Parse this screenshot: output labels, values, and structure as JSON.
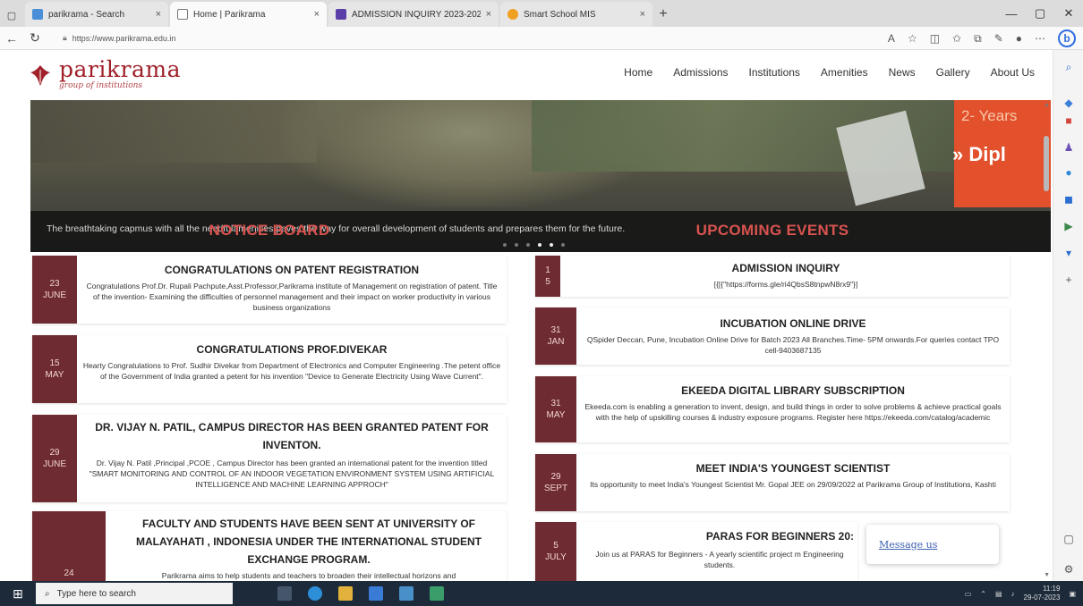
{
  "browser": {
    "tabs": [
      {
        "title": "parikrama - Search",
        "favicon": "search-favicon",
        "active": false
      },
      {
        "title": "Home | Parikrama",
        "favicon": "page-favicon",
        "active": true
      },
      {
        "title": "ADMISSION INQUIRY 2023-2024",
        "favicon": "forms-favicon",
        "active": false
      },
      {
        "title": "Smart School MIS",
        "favicon": "school-favicon",
        "active": false
      }
    ],
    "url": "https://www.parikrama.edu.in"
  },
  "site": {
    "brand": "parikrama",
    "tagline": "group of institutions",
    "nav": [
      "Home",
      "Admissions",
      "Institutions",
      "Amenities",
      "News",
      "Gallery",
      "About Us"
    ]
  },
  "hero": {
    "promo_line1": "2- Years",
    "promo_line2": "» Dipl",
    "caption": "The breathtaking capmus with all the needfulamenities paves the way for overall development of students and prepares them for the future.",
    "slide_count": 6,
    "active_slide": 4
  },
  "notice_board": {
    "title": "NOTICE BOARD",
    "items": [
      {
        "day": "23",
        "month": "JUNE",
        "title": "CONGRATULATIONS ON PATENT REGISTRATION",
        "desc": "Congratulations Prof.Dr. Rupali Pachpute,Asst.Professor,Parikrama institute of Management on registration of patent. Title of the invention- Examining the difficulties of personnel management and their impact on worker productivity in various business organizations"
      },
      {
        "day": "15",
        "month": "MAY",
        "title": "CONGRATULATIONS PROF.DIVEKAR",
        "desc": "Hearty Congratulations to Prof. Sudhir Divekar from Department of Electronics and Computer Engineering .The petent office of the Government of India granted a petent for his invention \"Device to Generate Electricity Using Wave Current\"."
      },
      {
        "day": "29",
        "month": "JUNE",
        "title": "DR. VIJAY N. PATIL, CAMPUS DIRECTOR HAS BEEN GRANTED PATENT FOR INVENTON.",
        "desc": "Dr. Vijay N. Patil ,Principal ,PCOE , Campus Director has been granted an international patent for the invention titled \"SMART MONITORING AND CONTROL OF AN INDOOR VEGETATION ENVIRONMENT SYSTEM USING ARTIFICIAL INTELLIGENCE AND MACHINE LEARNING APPROCH\""
      },
      {
        "day": "24",
        "month": "",
        "title": "FACULTY AND STUDENTS HAVE BEEN SENT AT UNIVERSITY OF MALAYAHATI , INDONESIA UNDER THE INTERNATIONAL STUDENT EXCHANGE PROGRAM.",
        "desc": "Parikrama aims to help students and teachers to broaden their intellectual horizons and"
      }
    ]
  },
  "events": {
    "title": "UPCOMING EVENTS",
    "items": [
      {
        "day": "1",
        "month": "5",
        "title": "ADMISSION INQUIRY",
        "desc": "[{[{\"https://forms.gle/ri4QbsS8tnpwN8rx9\"}]"
      },
      {
        "day": "31",
        "month": "JAN",
        "title": "INCUBATION ONLINE DRIVE",
        "desc": "QSpider Deccan, Pune, Incubation Online Drive for Batch 2023 All Branches.Time- 5PM onwards.For queries contact TPO cell-9403687135"
      },
      {
        "day": "31",
        "month": "MAY",
        "title": "EKEEDA DIGITAL LIBRARY SUBSCRIPTION",
        "desc": "Ekeeda.com is enabling a generation to invent, design, and build things in order to solve problems & achieve practical goals with the help of upskilling courses & industry exposure programs. Register here https://ekeeda.com/catalog/academic"
      },
      {
        "day": "29",
        "month": "SEPT",
        "title": "MEET INDIA'S YOUNGEST SCIENTIST",
        "desc": "Its opportunity to meet India's Youngest Scientist Mr. Gopal JEE on 29/09/2022 at Parikrama Group of Institutions, Kashti"
      },
      {
        "day": "5",
        "month": "JULY",
        "title": "PARAS FOR BEGINNERS 20:",
        "desc": "Join us at PARAS for Beginners - A yearly scientific project m Engineering students."
      }
    ]
  },
  "message_widget": {
    "label": "Message us"
  },
  "taskbar": {
    "search_placeholder": "Type here to search",
    "time": "11:19",
    "date": "29-07-2023"
  }
}
